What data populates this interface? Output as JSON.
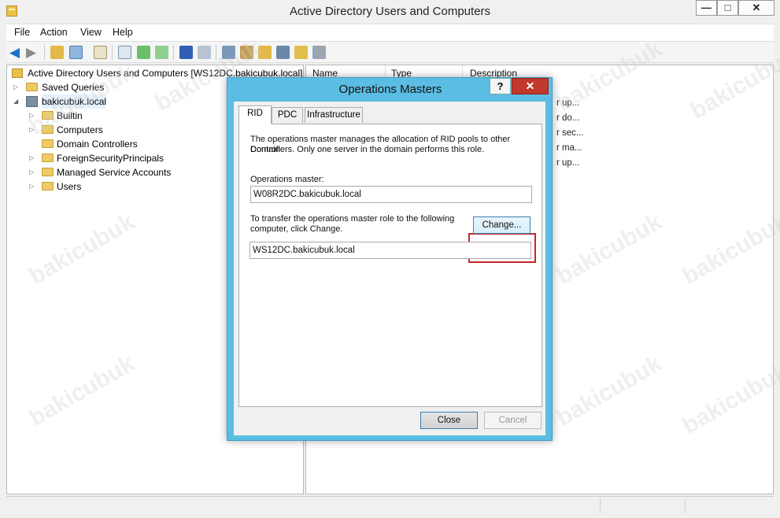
{
  "window": {
    "title": "Active Directory Users and Computers",
    "min_glyph": "—",
    "max_glyph": "□",
    "close_glyph": "✕"
  },
  "menu": {
    "items": [
      "File",
      "Action",
      "View",
      "Help"
    ]
  },
  "tree": {
    "root": "Active Directory Users and Computers [WS12DC.bakicubuk.local]",
    "saved_queries": "Saved Queries",
    "domain": "bakicubuk.local",
    "children": [
      "Builtin",
      "Computers",
      "Domain Controllers",
      "ForeignSecurityPrincipals",
      "Managed Service Accounts",
      "Users"
    ]
  },
  "list": {
    "columns": [
      "Name",
      "Type",
      "Description"
    ],
    "descriptions": [
      "r up...",
      "r do...",
      "r sec...",
      "r ma...",
      "r up..."
    ]
  },
  "dialog": {
    "title": "Operations Masters",
    "help": "?",
    "close": "✕",
    "tabs": [
      "RID",
      "PDC",
      "Infrastructure"
    ],
    "description_line1": "The operations master manages the allocation of RID pools to other Domain",
    "description_line2": "Controllers. Only one server in the domain performs this role.",
    "operations_master_label": "Operations master:",
    "operations_master_value": "W08R2DC.bakicubuk.local",
    "transfer_line1": "To transfer the operations master role to the following",
    "transfer_line2": "computer, click Change.",
    "target_value": "WS12DC.bakicubuk.local",
    "change_button": "Change...",
    "close_button": "Close",
    "cancel_button": "Cancel"
  },
  "watermark": "bakicubuk"
}
